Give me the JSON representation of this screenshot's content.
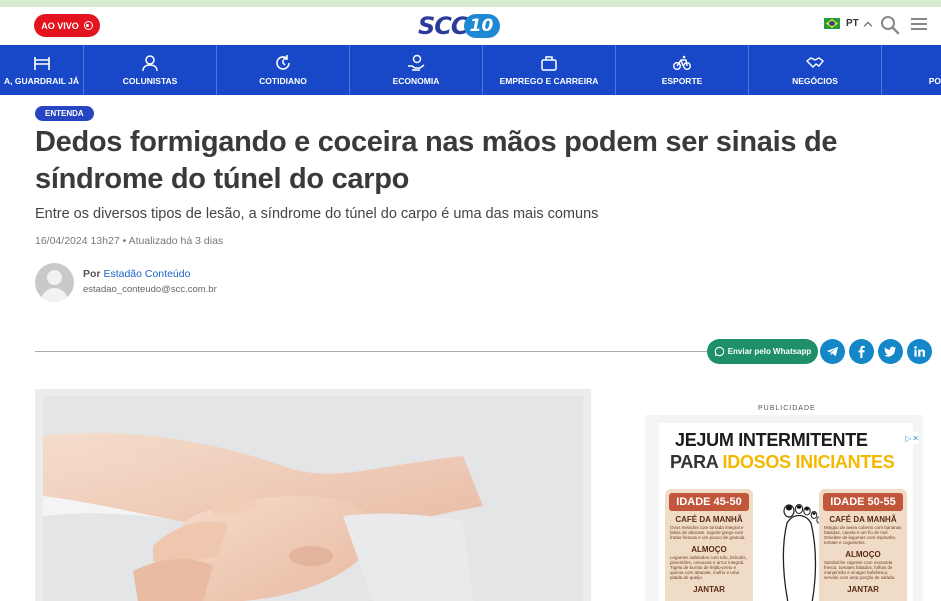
{
  "header": {
    "live_label": "AO VIVO",
    "logo_text": "SCC",
    "logo_badge": "10",
    "language": "PT",
    "icons": [
      "live-record-icon",
      "brazil-flag-icon",
      "chevron-up-icon",
      "search-icon",
      "menu-icon"
    ]
  },
  "nav": {
    "items": [
      {
        "label": "A, GUARDRAIL JÁ",
        "icon": "guardrail-icon"
      },
      {
        "label": "COLUNISTAS",
        "icon": "user-icon"
      },
      {
        "label": "COTIDIANO",
        "icon": "refresh-clock-icon"
      },
      {
        "label": "ECONOMIA",
        "icon": "money-hand-icon"
      },
      {
        "label": "EMPREGO E CARREIRA",
        "icon": "briefcase-icon"
      },
      {
        "label": "ESPORTE",
        "icon": "bicycle-icon"
      },
      {
        "label": "NEGÓCIOS",
        "icon": "handshake-icon"
      },
      {
        "label": "PO",
        "icon": "none"
      }
    ],
    "colors": {
      "background": "#1848c7"
    }
  },
  "article": {
    "tag": "ENTENDA",
    "title": "Dedos formigando e coceira nas mãos podem ser sinais de síndrome do túnel do carpo",
    "subtitle": "Entre os diversos tipos de lesão, a síndrome do túnel do carpo é uma das mais comuns",
    "dateline": "16/04/2024 13h27 • Atualizado há 3 dias",
    "author_prefix": "Por",
    "author_name": "Estadão Conteúdo",
    "author_email": "estadao_conteudo@scc.com.br"
  },
  "share": {
    "whatsapp_label": "Enviar pelo Whatsapp",
    "buttons": [
      {
        "name": "telegram",
        "icon": "telegram-icon",
        "color": "#1487c8"
      },
      {
        "name": "facebook",
        "icon": "facebook-icon",
        "color": "#1487c8"
      },
      {
        "name": "twitter",
        "icon": "twitter-icon",
        "color": "#1487c8"
      },
      {
        "name": "linkedin",
        "icon": "linkedin-icon",
        "color": "#1487c8"
      }
    ]
  },
  "ad": {
    "label": "PUBLICIDADE",
    "headline_1": "JEJUM INTERMITENTE",
    "headline_2_a": "PARA ",
    "headline_2_b": "IDOSOS INICIANTES",
    "left_card": {
      "title": "IDADE 45-50",
      "s1": "CAFÉ DA MANHÃ",
      "t1": "Ovos mexidos com torrada integral e fatias de abacate. Iogurte grego com frutas frescas e um pouco de granola.",
      "s2": "ALMOÇO",
      "t2": "Legumes salteados com tofu, brócolis, pimentões, cenouras e arroz integral. Tigela de burrito de feijão-preto e quinoa com abacate, molho e uma pitada de queijo.",
      "s3": "JANTAR"
    },
    "right_card": {
      "title": "IDADE 50-55",
      "s1": "CAFÉ DA MANHÃ",
      "t1": "Mingau de aveia coberto com bananas fatiadas, canela e um fio de mel. Omelete de legumes com espinafre, tomate e cogumelos.",
      "s2": "ALMOÇO",
      "t2": "Sanduíche caprese com mozarela fresca, tomates fatiados, folhas de manjericão e vinagre balsâmico, servido com uma porção de salada.",
      "s3": "JANTAR"
    }
  }
}
